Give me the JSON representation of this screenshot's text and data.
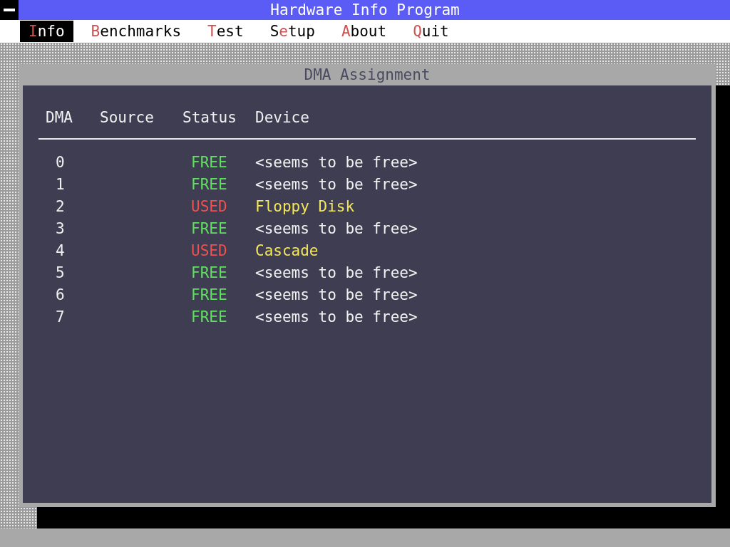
{
  "window": {
    "title": "Hardware Info Program"
  },
  "menu": [
    {
      "key": "I",
      "post": "nfo",
      "selected": true
    },
    {
      "key": "B",
      "post": "enchmarks",
      "selected": false
    },
    {
      "key": "T",
      "post": "est",
      "selected": false
    },
    {
      "pre": "S",
      "key": "e",
      "post": "tup",
      "selected": false
    },
    {
      "key": "A",
      "post": "bout",
      "selected": false
    },
    {
      "key": "Q",
      "post": "uit",
      "selected": false
    }
  ],
  "dialog": {
    "title": "DMA Assignment",
    "columns": [
      "DMA",
      "Source",
      "Status",
      "Device"
    ],
    "rows": [
      {
        "dma": "0",
        "status": "FREE",
        "kind": "free",
        "device": "<seems to be free>"
      },
      {
        "dma": "1",
        "status": "FREE",
        "kind": "free",
        "device": "<seems to be free>"
      },
      {
        "dma": "2",
        "status": "USED",
        "kind": "used",
        "device": "Floppy Disk"
      },
      {
        "dma": "3",
        "status": "FREE",
        "kind": "free",
        "device": "<seems to be free>"
      },
      {
        "dma": "4",
        "status": "USED",
        "kind": "used",
        "device": "Cascade"
      },
      {
        "dma": "5",
        "status": "FREE",
        "kind": "free",
        "device": "<seems to be free>"
      },
      {
        "dma": "6",
        "status": "FREE",
        "kind": "free",
        "device": "<seems to be free>"
      },
      {
        "dma": "7",
        "status": "FREE",
        "kind": "free",
        "device": "<seems to be free>"
      }
    ]
  }
}
